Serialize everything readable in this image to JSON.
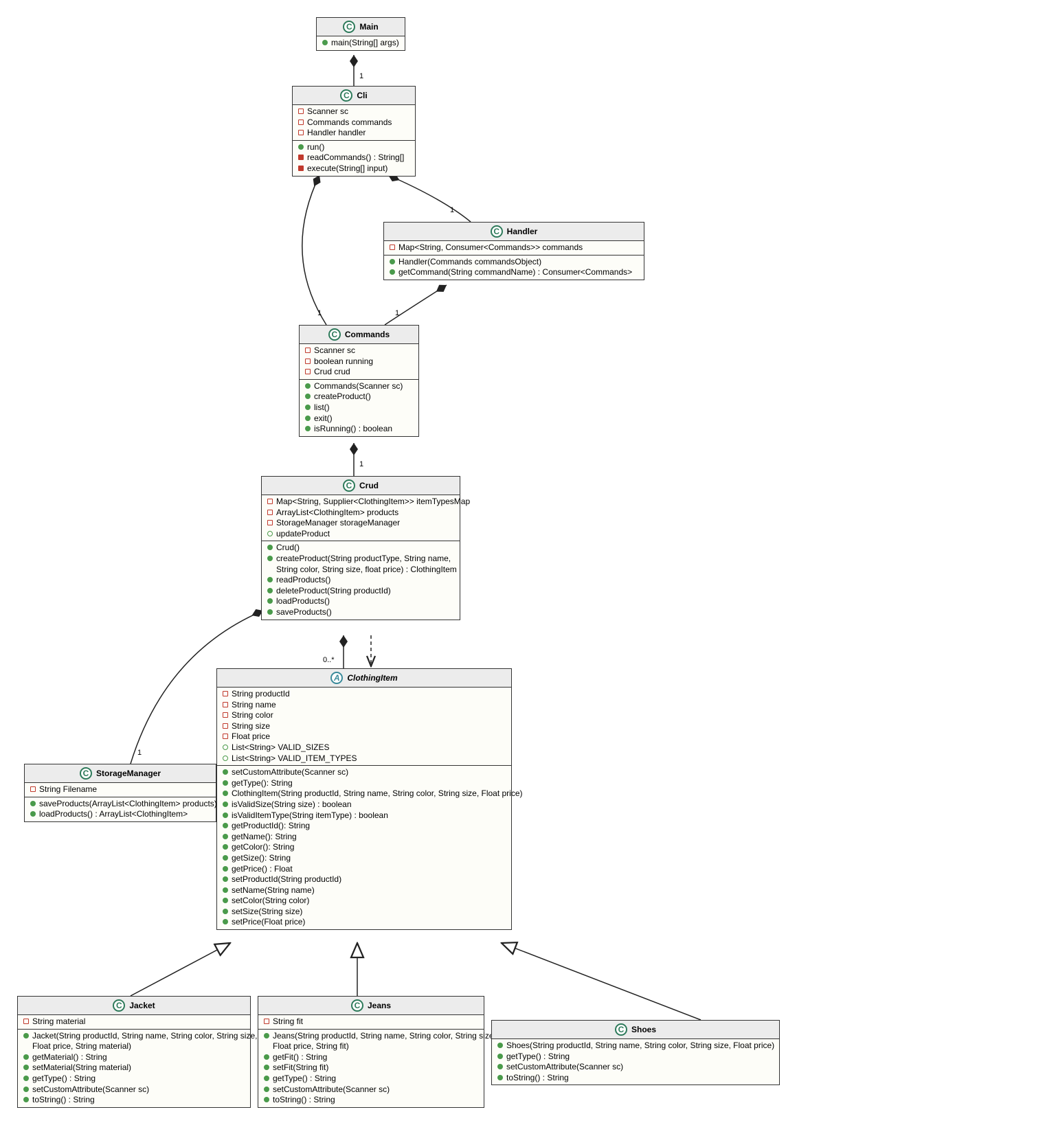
{
  "classes": {
    "Main": {
      "stereotype": "C",
      "name": "Main",
      "methods": [
        {
          "vis": "pub-circle",
          "sig": "main(String[] args)"
        }
      ]
    },
    "Cli": {
      "stereotype": "C",
      "name": "Cli",
      "fields": [
        {
          "vis": "priv-square-open",
          "sig": "Scanner sc"
        },
        {
          "vis": "priv-square-open",
          "sig": "Commands commands"
        },
        {
          "vis": "priv-square-open",
          "sig": "Handler handler"
        }
      ],
      "methods": [
        {
          "vis": "pub-circle",
          "sig": "run()"
        },
        {
          "vis": "priv-square",
          "sig": "readCommands() : String[]"
        },
        {
          "vis": "priv-square",
          "sig": "execute(String[] input)"
        }
      ]
    },
    "Handler": {
      "stereotype": "C",
      "name": "Handler",
      "fields": [
        {
          "vis": "priv-square-open",
          "sig": "Map<String, Consumer<Commands>> commands"
        }
      ],
      "methods": [
        {
          "vis": "pub-circle",
          "sig": "Handler(Commands commandsObject)"
        },
        {
          "vis": "pub-circle",
          "sig": "getCommand(String commandName) : Consumer<Commands>"
        }
      ]
    },
    "Commands": {
      "stereotype": "C",
      "name": "Commands",
      "fields": [
        {
          "vis": "priv-square-open",
          "sig": "Scanner sc"
        },
        {
          "vis": "priv-square-open",
          "sig": "boolean running"
        },
        {
          "vis": "priv-square-open",
          "sig": "Crud crud"
        }
      ],
      "methods": [
        {
          "vis": "pub-circle",
          "sig": "Commands(Scanner sc)"
        },
        {
          "vis": "pub-circle",
          "sig": "createProduct()"
        },
        {
          "vis": "pub-circle",
          "sig": "list()"
        },
        {
          "vis": "pub-circle",
          "sig": "exit()"
        },
        {
          "vis": "pub-circle",
          "sig": "isRunning() : boolean"
        }
      ]
    },
    "Crud": {
      "stereotype": "C",
      "name": "Crud",
      "fields": [
        {
          "vis": "priv-square-open",
          "sig": "Map<String, Supplier<ClothingItem>> itemTypesMap"
        },
        {
          "vis": "priv-square-open",
          "sig": "ArrayList<ClothingItem> products"
        },
        {
          "vis": "priv-square-open",
          "sig": "StorageManager storageManager"
        },
        {
          "vis": "pub-circle-open",
          "sig": "updateProduct"
        }
      ],
      "methods": [
        {
          "vis": "pub-circle",
          "sig": "Crud()"
        },
        {
          "vis": "pub-circle",
          "sig": "createProduct(String productType, String name,"
        },
        {
          "vis": "",
          "sig": "String color, String size, float price) : ClothingItem"
        },
        {
          "vis": "pub-circle",
          "sig": "readProducts()"
        },
        {
          "vis": "pub-circle",
          "sig": "deleteProduct(String productId)"
        },
        {
          "vis": "pub-circle",
          "sig": "loadProducts()"
        },
        {
          "vis": "pub-circle",
          "sig": "saveProducts()"
        }
      ]
    },
    "StorageManager": {
      "stereotype": "C",
      "name": "StorageManager",
      "fields": [
        {
          "vis": "priv-square-open",
          "sig": "String Filename"
        }
      ],
      "methods": [
        {
          "vis": "pub-circle",
          "sig": "saveProducts(ArrayList<ClothingItem> products)"
        },
        {
          "vis": "pub-circle",
          "sig": "loadProducts() : ArrayList<ClothingItem>"
        }
      ]
    },
    "ClothingItem": {
      "stereotype": "A",
      "name": "ClothingItem",
      "abstract": true,
      "fields": [
        {
          "vis": "priv-square-open",
          "sig": "String productId"
        },
        {
          "vis": "priv-square-open",
          "sig": "String name"
        },
        {
          "vis": "priv-square-open",
          "sig": "String color"
        },
        {
          "vis": "priv-square-open",
          "sig": "String size"
        },
        {
          "vis": "priv-square-open",
          "sig": "Float price"
        },
        {
          "vis": "pub-circle-open",
          "sig": "List<String> VALID_SIZES"
        },
        {
          "vis": "pub-circle-open",
          "sig": "List<String> VALID_ITEM_TYPES"
        }
      ],
      "methods": [
        {
          "vis": "pub-circle",
          "sig": "setCustomAttribute(Scanner sc)"
        },
        {
          "vis": "pub-circle",
          "sig": "getType(): String"
        },
        {
          "vis": "pub-circle",
          "sig": "ClothingItem(String productId, String name, String color, String size, Float price)"
        },
        {
          "vis": "pub-circle",
          "sig": "isValidSize(String size) : boolean"
        },
        {
          "vis": "pub-circle",
          "sig": "isValidItemType(String itemType) : boolean"
        },
        {
          "vis": "pub-circle",
          "sig": "getProductId(): String"
        },
        {
          "vis": "pub-circle",
          "sig": "getName(): String"
        },
        {
          "vis": "pub-circle",
          "sig": "getColor(): String"
        },
        {
          "vis": "pub-circle",
          "sig": "getSize(): String"
        },
        {
          "vis": "pub-circle",
          "sig": "getPrice() : Float"
        },
        {
          "vis": "pub-circle",
          "sig": "setProductId(String productId)"
        },
        {
          "vis": "pub-circle",
          "sig": "setName(String name)"
        },
        {
          "vis": "pub-circle",
          "sig": "setColor(String color)"
        },
        {
          "vis": "pub-circle",
          "sig": "setSize(String size)"
        },
        {
          "vis": "pub-circle",
          "sig": "setPrice(Float price)"
        }
      ]
    },
    "Jacket": {
      "stereotype": "C",
      "name": "Jacket",
      "fields": [
        {
          "vis": "priv-square-open",
          "sig": "String material"
        }
      ],
      "methods": [
        {
          "vis": "pub-circle",
          "sig": "Jacket(String productId, String name, String color, String size,"
        },
        {
          "vis": "",
          "sig": "Float price, String material)"
        },
        {
          "vis": "pub-circle",
          "sig": "getMaterial() : String"
        },
        {
          "vis": "pub-circle",
          "sig": "setMaterial(String material)"
        },
        {
          "vis": "pub-circle",
          "sig": "getType() : String"
        },
        {
          "vis": "pub-circle",
          "sig": "setCustomAttribute(Scanner sc)"
        },
        {
          "vis": "pub-circle",
          "sig": "toString() : String"
        }
      ]
    },
    "Jeans": {
      "stereotype": "C",
      "name": "Jeans",
      "fields": [
        {
          "vis": "priv-square-open",
          "sig": "String fit"
        }
      ],
      "methods": [
        {
          "vis": "pub-circle",
          "sig": "Jeans(String productId, String name, String color, String size,"
        },
        {
          "vis": "",
          "sig": "Float price, String fit)"
        },
        {
          "vis": "pub-circle",
          "sig": "getFit() : String"
        },
        {
          "vis": "pub-circle",
          "sig": "setFit(String fit)"
        },
        {
          "vis": "pub-circle",
          "sig": "getType() : String"
        },
        {
          "vis": "pub-circle",
          "sig": "setCustomAttribute(Scanner sc)"
        },
        {
          "vis": "pub-circle",
          "sig": "toString() : String"
        }
      ]
    },
    "Shoes": {
      "stereotype": "C",
      "name": "Shoes",
      "methods": [
        {
          "vis": "pub-circle",
          "sig": "Shoes(String productId, String name, String color, String size, Float price)"
        },
        {
          "vis": "pub-circle",
          "sig": "getType() : String"
        },
        {
          "vis": "pub-circle",
          "sig": "setCustomAttribute(Scanner sc)"
        },
        {
          "vis": "pub-circle",
          "sig": "toString() : String"
        }
      ]
    }
  },
  "multiplicities": {
    "main_cli": "1",
    "cli_handler": "1",
    "cli_commands": "1",
    "handler_commands": "1",
    "commands_crud": "1",
    "crud_storage": "1",
    "crud_clothing": "0..*"
  }
}
